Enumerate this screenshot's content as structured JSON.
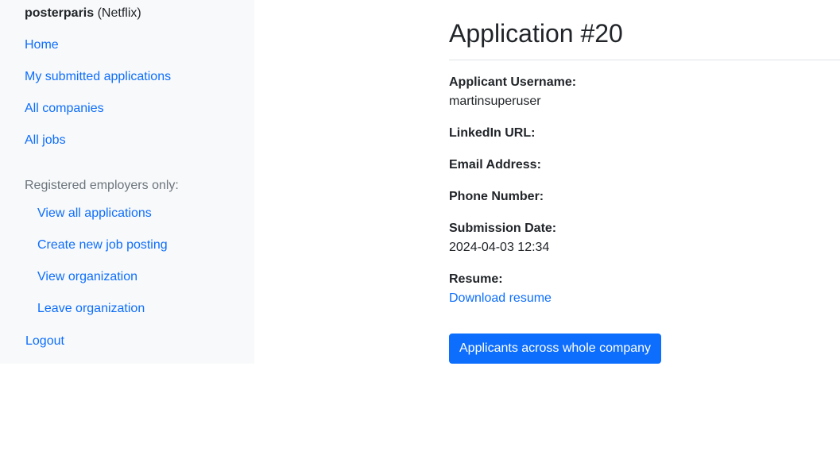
{
  "sidebar": {
    "username": "posterparis",
    "company": "(Netflix)",
    "nav": {
      "home": "Home",
      "my_applications": "My submitted applications",
      "all_companies": "All companies",
      "all_jobs": "All jobs"
    },
    "employers_label": "Registered employers only:",
    "employer_nav": {
      "view_applications": "View all applications",
      "create_job": "Create new job posting",
      "view_org": "View organization",
      "leave_org": "Leave organization"
    },
    "logout": "Logout"
  },
  "main": {
    "title": "Application #20",
    "fields": {
      "username_label": "Applicant Username:",
      "username_value": "martinsuperuser",
      "linkedin_label": "LinkedIn URL:",
      "email_label": "Email Address:",
      "phone_label": "Phone Number:",
      "date_label": "Submission Date:",
      "date_value": "2024-04-03 12:34",
      "resume_label": "Resume:",
      "resume_link": "Download resume"
    },
    "company_button": "Applicants across whole company"
  },
  "colors": {
    "link": "#0d6efd",
    "sidebar_bg": "#f8f9fa",
    "muted": "#6c757d",
    "text": "#212529"
  }
}
